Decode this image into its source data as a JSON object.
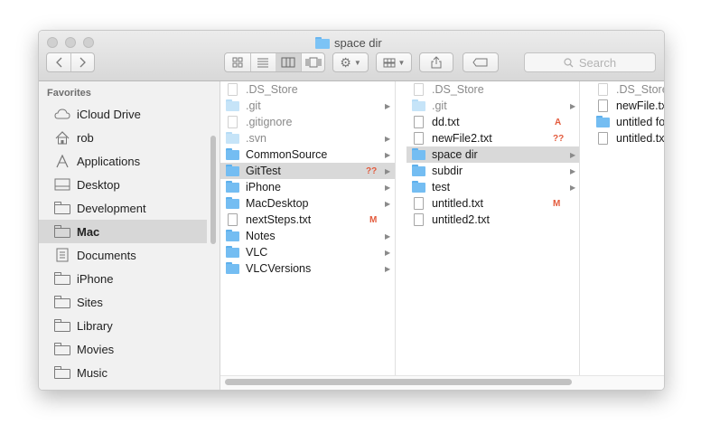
{
  "window": {
    "title": "space dir"
  },
  "toolbar": {
    "back_icon": "chevron-left-icon",
    "forward_icon": "chevron-right-icon",
    "view_icons": [
      "icon-view-icon",
      "list-view-icon",
      "column-view-icon",
      "cover-flow-icon"
    ],
    "selected_view": "column-view",
    "action_icon": "gear-icon",
    "arrange_icon": "arrange-grid-icon",
    "share_icon": "share-icon",
    "tag_icon": "tag-icon"
  },
  "search": {
    "placeholder": "Search"
  },
  "sidebar": {
    "heading": "Favorites",
    "items": [
      {
        "label": "iCloud Drive",
        "icon": "cloud-icon",
        "selected": false
      },
      {
        "label": "rob",
        "icon": "home-icon",
        "selected": false
      },
      {
        "label": "Applications",
        "icon": "applications-icon",
        "selected": false
      },
      {
        "label": "Desktop",
        "icon": "desktop-icon",
        "selected": false
      },
      {
        "label": "Development",
        "icon": "folder-icon",
        "selected": false
      },
      {
        "label": "Mac",
        "icon": "folder-icon",
        "selected": true
      },
      {
        "label": "Documents",
        "icon": "documents-icon",
        "selected": false
      },
      {
        "label": "iPhone",
        "icon": "folder-icon",
        "selected": false
      },
      {
        "label": "Sites",
        "icon": "folder-icon",
        "selected": false
      },
      {
        "label": "Library",
        "icon": "folder-icon",
        "selected": false
      },
      {
        "label": "Movies",
        "icon": "folder-icon",
        "selected": false
      },
      {
        "label": "Music",
        "icon": "folder-icon",
        "selected": false
      }
    ]
  },
  "columns": [
    {
      "items": [
        {
          "name": ".DS_Store",
          "type": "file",
          "hidden": true
        },
        {
          "name": ".git",
          "type": "folder",
          "hidden": true,
          "arrow": true
        },
        {
          "name": ".gitignore",
          "type": "file",
          "hidden": true
        },
        {
          "name": ".svn",
          "type": "folder",
          "hidden": true,
          "arrow": true
        },
        {
          "name": "CommonSource",
          "type": "folder",
          "arrow": true
        },
        {
          "name": "GitTest",
          "type": "folder",
          "arrow": true,
          "badge": "??",
          "selected": true
        },
        {
          "name": "iPhone",
          "type": "folder",
          "arrow": true
        },
        {
          "name": "MacDesktop",
          "type": "folder",
          "arrow": true
        },
        {
          "name": "nextSteps.txt",
          "type": "file",
          "badge": "M"
        },
        {
          "name": "Notes",
          "type": "folder",
          "arrow": true
        },
        {
          "name": "VLC",
          "type": "folder",
          "arrow": true
        },
        {
          "name": "VLCVersions",
          "type": "folder",
          "arrow": true
        }
      ]
    },
    {
      "items": [
        {
          "name": ".DS_Store",
          "type": "file",
          "hidden": true
        },
        {
          "name": ".git",
          "type": "folder",
          "hidden": true,
          "arrow": true
        },
        {
          "name": "dd.txt",
          "type": "file",
          "badge": "A"
        },
        {
          "name": "newFile2.txt",
          "type": "file",
          "badge": "??"
        },
        {
          "name": "space dir",
          "type": "folder",
          "arrow": true,
          "selected": true
        },
        {
          "name": "subdir",
          "type": "folder",
          "arrow": true
        },
        {
          "name": "test",
          "type": "folder",
          "arrow": true
        },
        {
          "name": "untitled.txt",
          "type": "file",
          "badge": "M"
        },
        {
          "name": "untitled2.txt",
          "type": "file"
        }
      ]
    },
    {
      "items": [
        {
          "name": ".DS_Store",
          "type": "file",
          "hidden": true
        },
        {
          "name": "newFile.txt",
          "type": "file"
        },
        {
          "name": "untitled folder",
          "type": "folder"
        },
        {
          "name": "untitled.txt",
          "type": "file"
        }
      ]
    }
  ],
  "colors": {
    "folder": "#74bdf2",
    "badge": "#e35a3c",
    "selection": "#d9d9d9"
  }
}
